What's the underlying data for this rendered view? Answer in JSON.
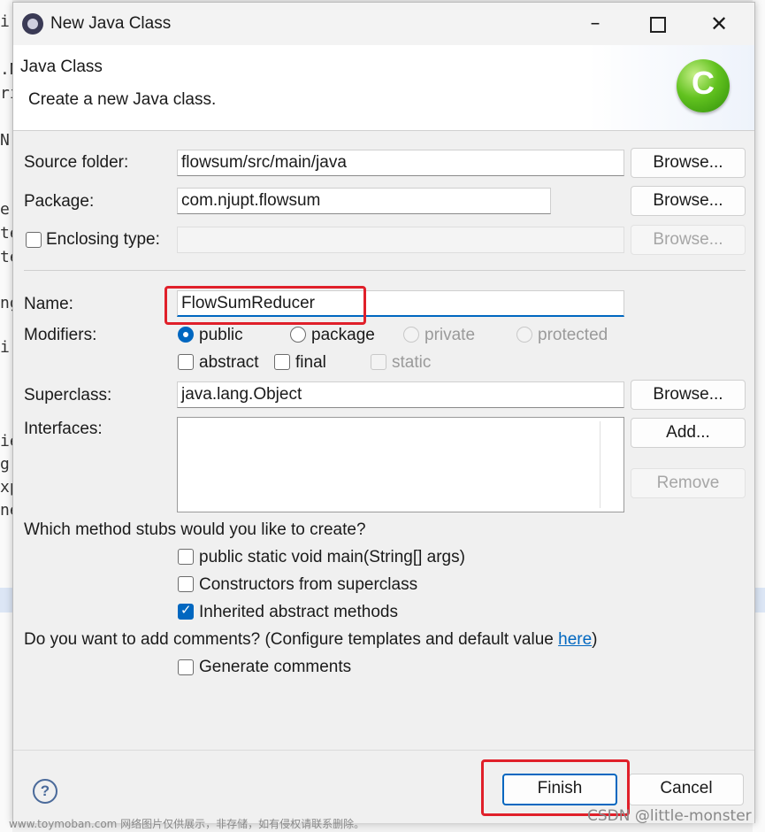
{
  "window": {
    "title": "New Java Class"
  },
  "banner": {
    "title": "Java Class",
    "description": "Create a new Java class.",
    "icon": "java-class-icon"
  },
  "source_folder": {
    "label": "Source folder:",
    "value": "flowsum/src/main/java",
    "browse": "Browse..."
  },
  "package": {
    "label": "Package:",
    "value": "com.njupt.flowsum",
    "browse": "Browse..."
  },
  "enclosing": {
    "label": "Enclosing type:",
    "value": "",
    "checked": false,
    "browse": "Browse..."
  },
  "name": {
    "label": "Name:",
    "value": "FlowSumReducer"
  },
  "modifiers": {
    "label": "Modifiers:",
    "public": "public",
    "package": "package",
    "private": "private",
    "protected": "protected",
    "abstract": "abstract",
    "final": "final",
    "static": "static",
    "selected": "public"
  },
  "superclass": {
    "label": "Superclass:",
    "value": "java.lang.Object",
    "browse": "Browse..."
  },
  "interfaces": {
    "label": "Interfaces:",
    "add": "Add...",
    "remove": "Remove"
  },
  "stubs": {
    "question": "Which method stubs would you like to create?",
    "main": "public static void main(String[] args)",
    "constructors": "Constructors from superclass",
    "inherited": "Inherited abstract methods",
    "main_checked": false,
    "constructors_checked": false,
    "inherited_checked": true
  },
  "comments": {
    "question_prefix": "Do you want to add comments? (Configure templates and default value ",
    "link": "here",
    "question_suffix": ")",
    "generate": "Generate comments",
    "generate_checked": false
  },
  "footer": {
    "finish": "Finish",
    "cancel": "Cancel",
    "help_icon": "help-icon"
  },
  "background_fragments": [
    "i:",
    ".N",
    "ri",
    "N",
    "e",
    "te",
    "te",
    "ng",
    "i",
    "ie",
    "g",
    "xp",
    "ne"
  ],
  "watermarks": {
    "left": "www.toymoban.com 网络图片仅供展示，非存储，如有侵权请联系删除。",
    "right": "CSDN @little-monster"
  },
  "colors": {
    "accent": "#0067c0",
    "highlight": "#e0202a",
    "class_icon": "#62c21f"
  }
}
